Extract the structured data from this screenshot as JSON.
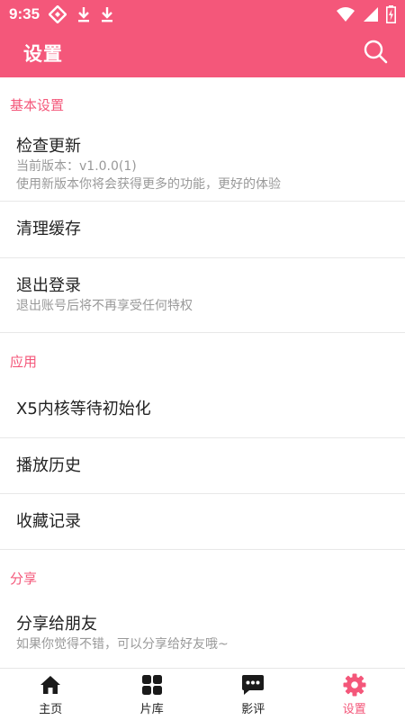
{
  "status_bar": {
    "time": "9:35",
    "left_icons": [
      "tag-icon",
      "download-icon",
      "download-icon"
    ],
    "right_icons": [
      "wifi-icon",
      "signal-icon",
      "battery-charging-icon"
    ]
  },
  "app_bar": {
    "title": "设置",
    "search_icon": "search-icon"
  },
  "sections": [
    {
      "header": "基本设置",
      "items": [
        {
          "title": "检查更新",
          "subtitles": [
            "当前版本：v1.0.0(1)",
            "使用新版本你将会获得更多的功能，更好的体验"
          ]
        },
        {
          "title": "清理缓存",
          "subtitles": []
        },
        {
          "title": "退出登录",
          "subtitles": [
            "退出账号后将不再享受任何特权"
          ]
        }
      ]
    },
    {
      "header": "应用",
      "items": [
        {
          "title": "X5内核等待初始化",
          "subtitles": []
        },
        {
          "title": "播放历史",
          "subtitles": []
        },
        {
          "title": "收藏记录",
          "subtitles": []
        }
      ]
    },
    {
      "header": "分享",
      "items": [
        {
          "title": "分享给朋友",
          "subtitles": [
            "如果你觉得不错，可以分享给好友哦~"
          ]
        }
      ]
    }
  ],
  "bottom_nav": [
    {
      "label": "主页",
      "icon": "home-icon",
      "active": false
    },
    {
      "label": "片库",
      "icon": "grid-icon",
      "active": false
    },
    {
      "label": "影评",
      "icon": "chat-bubble-icon",
      "active": false
    },
    {
      "label": "设置",
      "icon": "gear-icon",
      "active": true
    }
  ],
  "colors": {
    "accent": "#f4577a",
    "text_primary": "#222222",
    "text_secondary": "#999999",
    "divider": "#e8e8e8"
  }
}
